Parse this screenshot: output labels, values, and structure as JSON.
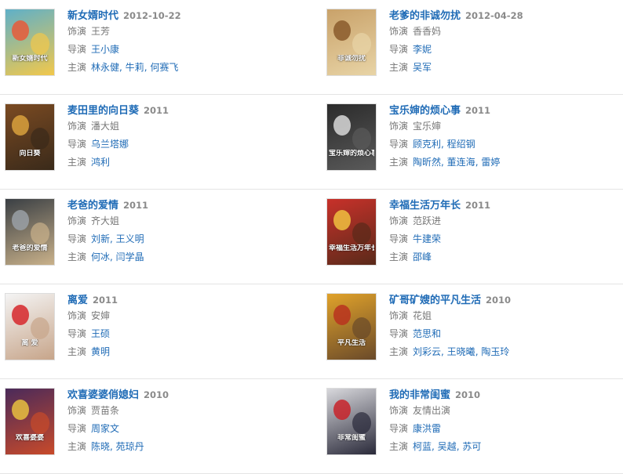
{
  "labels": {
    "role": "饰演",
    "director": "导演",
    "cast": "主演"
  },
  "rows": [
    [
      {
        "title": "新女婿时代",
        "year": "2012-10-22",
        "role": "王芳",
        "directors": [
          "王小康"
        ],
        "cast": [
          "林永健",
          "牛莉",
          "何赛飞"
        ],
        "poster_text": "新女婿时代",
        "colors": [
          "#5fb0c8",
          "#e85a3a",
          "#f2c84b"
        ]
      },
      {
        "title": "老爹的非诚勿扰",
        "year": "2012-04-28",
        "role": "香香妈",
        "directors": [
          "李妮"
        ],
        "cast": [
          "吴军"
        ],
        "poster_text": "非诚勿扰",
        "colors": [
          "#c9a26a",
          "#8a5a2c",
          "#e8d4a6"
        ]
      }
    ],
    [
      {
        "title": "麦田里的向日葵",
        "year": "2011",
        "role": "潘大姐",
        "directors": [
          "乌兰塔娜"
        ],
        "cast": [
          "鸿利"
        ],
        "poster_text": "向日葵",
        "colors": [
          "#7a4a22",
          "#d9a13d",
          "#3a2a1a"
        ]
      },
      {
        "title": "宝乐婶的烦心事",
        "year": "2011",
        "role": "宝乐婶",
        "directors": [
          "顾克利",
          "程绍钢"
        ],
        "cast": [
          "陶昕然",
          "董连海",
          "雷婷"
        ],
        "poster_text": "宝乐婶的烦心事",
        "colors": [
          "#2b2b2b",
          "#d8d8d8",
          "#5a5a5a"
        ]
      }
    ],
    [
      {
        "title": "老爸的爱情",
        "year": "2011",
        "role": "齐大姐",
        "directors": [
          "刘新",
          "王义明"
        ],
        "cast": [
          "何冰",
          "闫学晶"
        ],
        "poster_text": "老爸的爱情",
        "colors": [
          "#3a3f44",
          "#9aa0a6",
          "#c9b18a"
        ]
      },
      {
        "title": "幸福生活万年长",
        "year": "2011",
        "role": "范跃进",
        "directors": [
          "牛建荣"
        ],
        "cast": [
          "邵峰"
        ],
        "poster_text": "幸福生活万年长",
        "colors": [
          "#c8312a",
          "#f0c040",
          "#5a2a1a"
        ]
      }
    ],
    [
      {
        "title": "离爱",
        "year": "2011",
        "role": "安婶",
        "directors": [
          "王硕"
        ],
        "cast": [
          "黄明"
        ],
        "poster_text": "离 爱",
        "colors": [
          "#f4f4f4",
          "#d6272b",
          "#c7a58a"
        ]
      },
      {
        "title": "矿哥矿嫂的平凡生活",
        "year": "2010",
        "role": "花姐",
        "directors": [
          "范思和"
        ],
        "cast": [
          "刘彩云",
          "王晓曦",
          "陶玉玲"
        ],
        "poster_text": "平凡生活",
        "colors": [
          "#e0a22a",
          "#b8321e",
          "#6a4a2a"
        ]
      }
    ],
    [
      {
        "title": "欢喜婆婆俏媳妇",
        "year": "2010",
        "role": "贾苗条",
        "directors": [
          "周家文"
        ],
        "cast": [
          "陈晓",
          "苑琼丹"
        ],
        "poster_text": "欢喜婆婆",
        "colors": [
          "#4a2a5a",
          "#e8c040",
          "#c84a2a"
        ]
      },
      {
        "title": "我的非常闺蜜",
        "year": "2010",
        "role": "友情出演",
        "directors": [
          "康洪雷"
        ],
        "cast": [
          "柯蓝",
          "吴越",
          "苏可"
        ],
        "poster_text": "非常闺蜜",
        "colors": [
          "#d8d8dc",
          "#c8232a",
          "#2a2a3a"
        ]
      }
    ]
  ]
}
